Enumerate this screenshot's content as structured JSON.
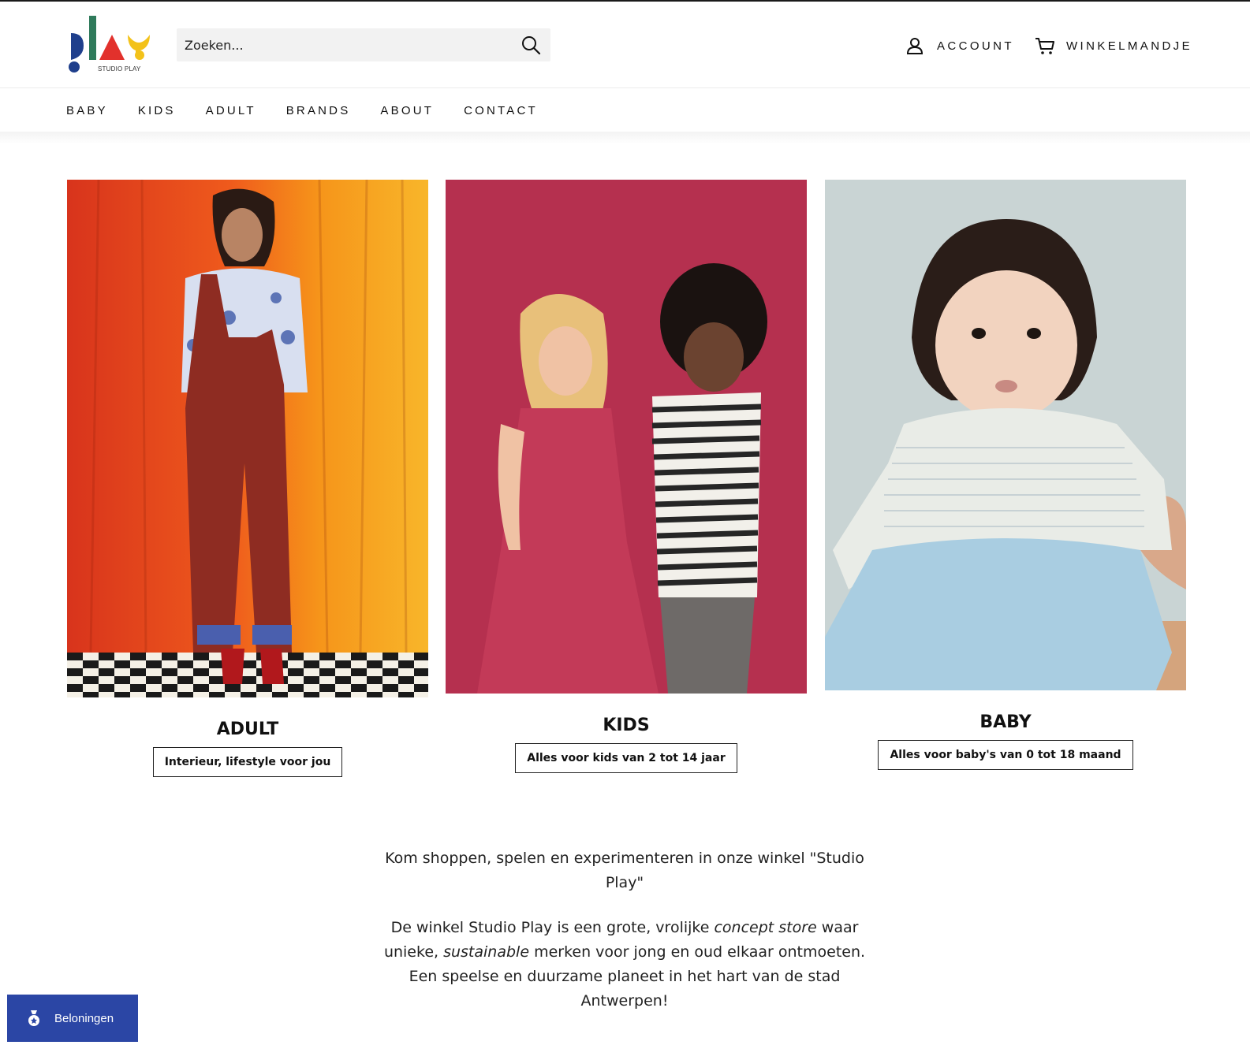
{
  "brand": {
    "logo_text": "PLAY",
    "logo_sub": "STUDIO PLAY"
  },
  "header": {
    "search_placeholder": "Zoeken...",
    "account_label": "ACCOUNT",
    "cart_label": "WINKELMANDJE"
  },
  "nav": {
    "items": [
      {
        "label": "BABY"
      },
      {
        "label": "KIDS"
      },
      {
        "label": "ADULT"
      },
      {
        "label": "BRANDS"
      },
      {
        "label": "ABOUT"
      },
      {
        "label": "CONTACT"
      }
    ]
  },
  "categories": [
    {
      "title": "ADULT",
      "button": "Interieur, lifestyle voor jou"
    },
    {
      "title": "KIDS",
      "button": "Alles voor kids van 2 tot 14 jaar"
    },
    {
      "title": "BABY",
      "button": "Alles voor baby's van 0 tot 18 maand"
    }
  ],
  "intro": {
    "p1": "Kom shoppen, spelen en experimenteren in onze winkel \"Studio Play\"",
    "p2_a": "De winkel Studio Play is een grote, vrolijke ",
    "p2_em1": "concept store",
    "p2_b": " waar unieke, ",
    "p2_em2": "sustainable",
    "p2_c": " merken voor jong en oud elkaar ontmoeten. Een speelse en duurzame planeet in het hart van de stad Antwerpen!"
  },
  "rewards": {
    "label": "Beloningen"
  },
  "colors": {
    "logo_blue": "#1f3f8c",
    "logo_green": "#2f7a5b",
    "logo_red": "#e2312c",
    "logo_yellow": "#f3c21a",
    "rewards_bg": "#2b46a5"
  }
}
